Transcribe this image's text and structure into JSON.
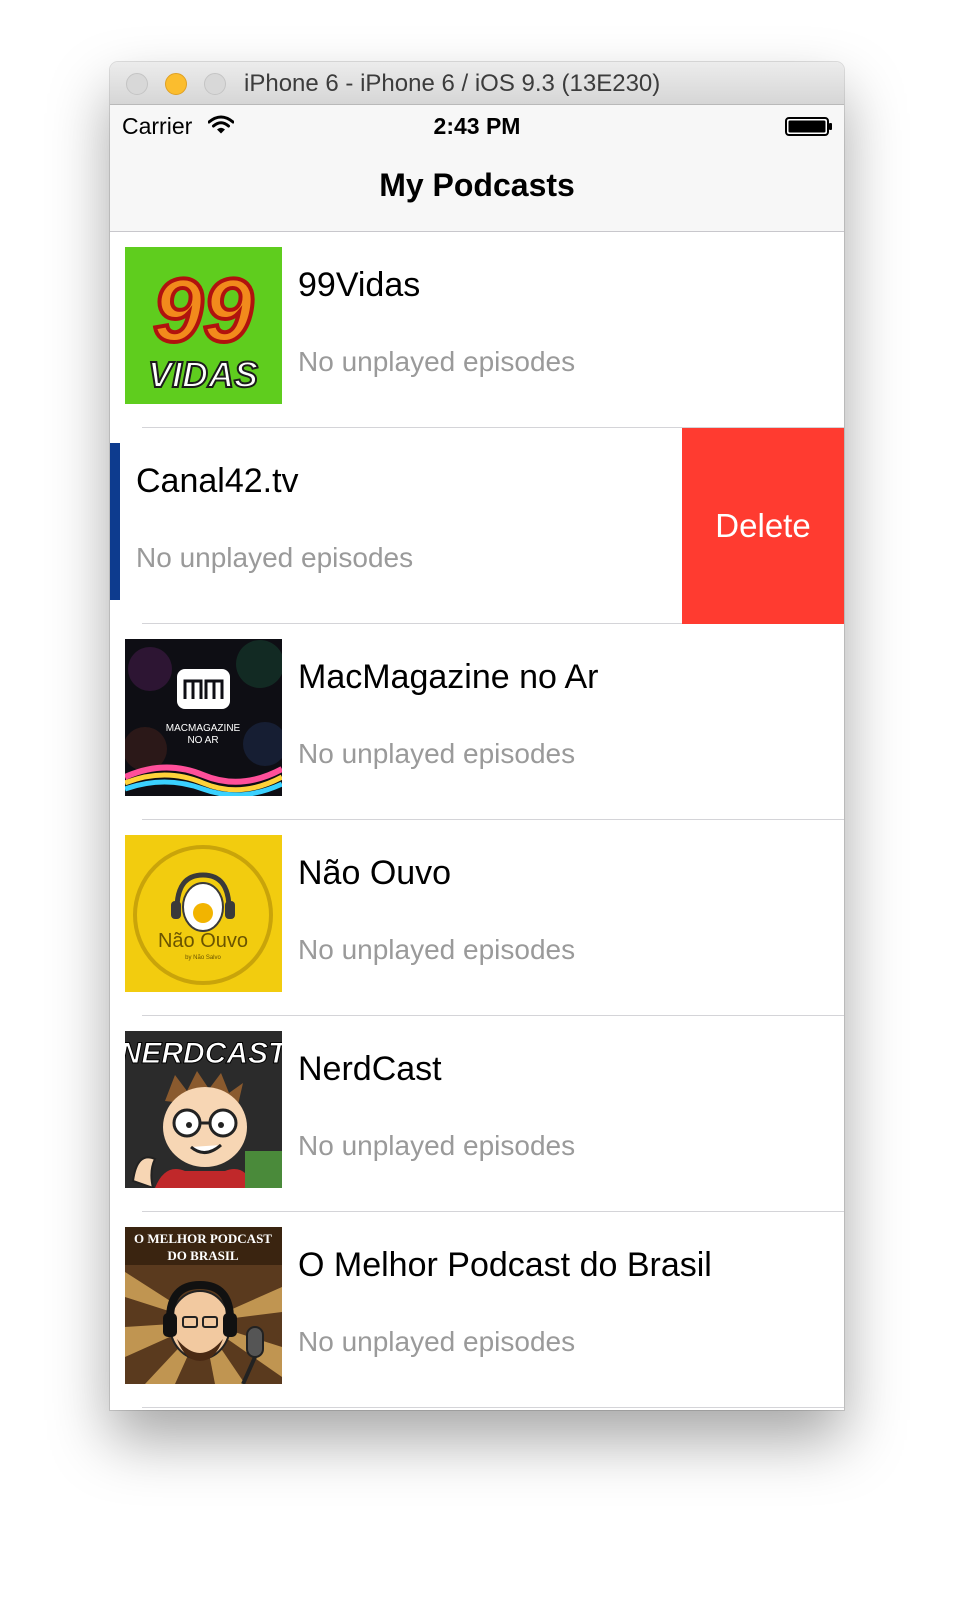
{
  "window": {
    "title": "iPhone 6 - iPhone 6 / iOS 9.3 (13E230)"
  },
  "status_bar": {
    "carrier": "Carrier",
    "time": "2:43 PM"
  },
  "nav": {
    "title": "My Podcasts"
  },
  "podcasts": [
    {
      "title": "99Vidas",
      "subtitle": "No unplayed episodes",
      "art_text": [
        "99",
        "VIDAS"
      ]
    },
    {
      "title": "Canal42.tv",
      "subtitle": "No unplayed episodes",
      "swiped": true,
      "delete_label": "Delete"
    },
    {
      "title": "MacMagazine no Ar",
      "subtitle": "No unplayed episodes",
      "art_text": [
        "MACMAGAZINE",
        "NO AR"
      ]
    },
    {
      "title": "Não Ouvo",
      "subtitle": "No unplayed episodes",
      "art_text": [
        "Não Ouvo",
        "by Não Salvo"
      ]
    },
    {
      "title": "NerdCast",
      "subtitle": "No unplayed episodes",
      "art_text": [
        "NERDCAST"
      ]
    },
    {
      "title": "O Melhor Podcast do Brasil",
      "subtitle": "No unplayed episodes",
      "art_text": [
        "O MELHOR PODCAST",
        "DO BRASIL"
      ]
    }
  ],
  "colors": {
    "delete": "#ff3b30",
    "subtitle": "#9a9a9a",
    "minimize": "#fbbd2e"
  }
}
